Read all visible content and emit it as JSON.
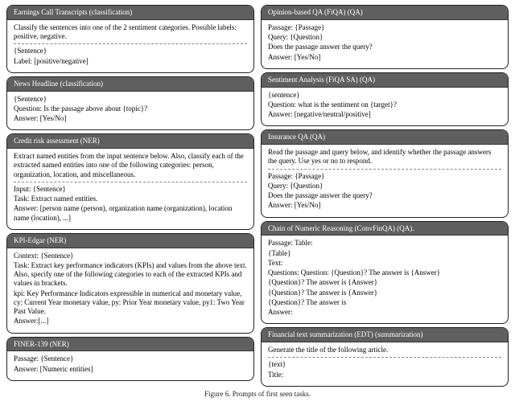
{
  "caption": "Figure 6. Prompts of first seen tasks.",
  "left": [
    {
      "title": "Earnings Call Transcripts (classification)",
      "sections": [
        [
          "Classify the sentences into one of the 2 sentiment categories. Possible labels: positive, negative."
        ],
        [
          "{Sentence}",
          "Label: [positive/negative]"
        ]
      ]
    },
    {
      "title": "News Headline (classification)",
      "sections": [
        [
          "{Sentence}",
          "Question: Is the passage above about {topic}?",
          "Answer: [Yes/No]"
        ]
      ]
    },
    {
      "title": "Credit risk assessment (NER)",
      "sections": [
        [
          "Extract named entities from the input sentence below. Also, classify each of the extracted named entities into one of the following categories: person, organization, location, and miscellaneous."
        ],
        [
          "Input: {Sentence}",
          "Task: Extract named entities.",
          "Answer: [person name (person), organization name (organization), location name (location), ...]"
        ]
      ]
    },
    {
      "title": "KPI-Edgar (NER)",
      "sections": [
        [
          "Context: {Sentence}",
          "Task: Extract key performance indicators (KPIs) and values from the above text. Also, specify one of the following categories to each of the extracted KPIs and values in brackets.",
          "kpi: Key Performance Indicators expressible in numerical and monetary value, cy: Current Year monetary value, py: Prior Year monetary value, py1: Two Year Past Value.",
          "Answer:[...]"
        ]
      ]
    },
    {
      "title": "FINER-139 (NER)",
      "sections": [
        [
          "Passage: {Sentence}",
          "Answer: [Numeric entities]"
        ]
      ]
    }
  ],
  "right": [
    {
      "title": "Opinion-based QA (FiQA) (QA)",
      "sections": [
        [
          "Passage: {Passage}",
          "Query: {Question}",
          "Does the passage answer the query?",
          "Answer: [Yes/No]"
        ]
      ]
    },
    {
      "title": "Sentiment Analysis (FiQA SA) (QA)",
      "sections": [
        [
          "{sentence}",
          "Question: what is the sentiment on {target}?",
          "Answer: [negative/neutral/positive]"
        ]
      ]
    },
    {
      "title": "Insurance QA (QA)",
      "sections": [
        [
          "Read the passage and query below, and identify whether the passage answers the query. Use yes or no to respond."
        ],
        [
          "Passage: {Passage}",
          "Query: {Question}",
          "Does the passage answer the query?",
          "Answer: [Yes/No]"
        ]
      ]
    },
    {
      "title": "Chain of Numeric Reasoning (ConvFinQA) (QA).",
      "sections": [
        [
          "Passage: Table:",
          "{Table}",
          "Text:",
          "Questions: Question: {Question}? The answer is {Answer}",
          "{Question}? The answer is {Answer}",
          "{Question}? The answer is {Answer}",
          "{Question}? The answer is",
          "Answer:"
        ]
      ]
    },
    {
      "title": "Financial text summarization (EDT) (summarization)",
      "sections": [
        [
          "Generate the title of the following article."
        ],
        [
          "{text}",
          "Title:"
        ]
      ]
    }
  ]
}
